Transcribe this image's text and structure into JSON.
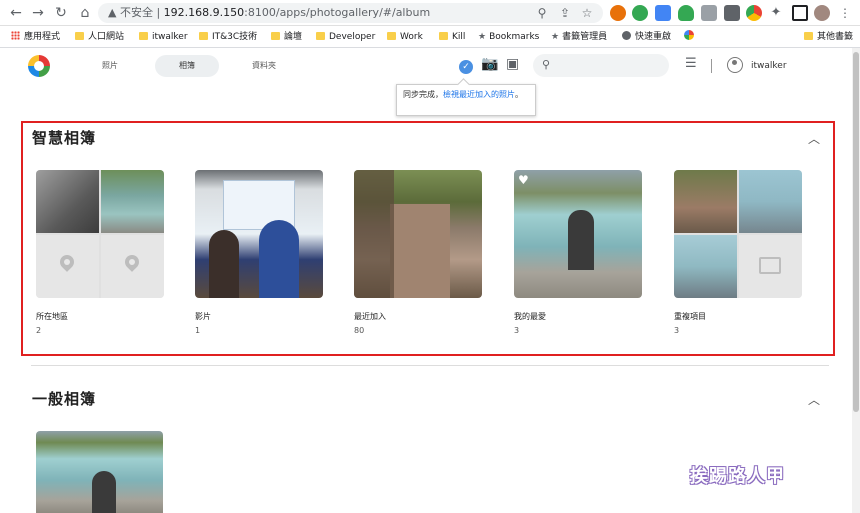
{
  "browser": {
    "insecure_label": "不安全",
    "url_host": "192.168.9.150",
    "url_path": ":8100/apps/photogallery/#/album"
  },
  "bookmarks": {
    "apps": "應用程式",
    "items": [
      "人口網站",
      "itwalker",
      "IT&3C技術",
      "論壇",
      "Developer",
      "Work",
      "Kill"
    ],
    "bookmarks": "Bookmarks",
    "manager": "書籤管理員",
    "speed": "快速重啟",
    "other": "其他書籤"
  },
  "header": {
    "tabs": [
      "照片",
      "相簿",
      "資料夾"
    ],
    "active_tab": 1,
    "username": "itwalker"
  },
  "tooltip": {
    "prefix": "同步完成，",
    "link": "檢視最近加入的照片",
    "suffix": "。"
  },
  "smart_albums": {
    "title": "智慧相簿",
    "items": [
      {
        "label": "所在地區",
        "count": "2"
      },
      {
        "label": "影片",
        "count": "1"
      },
      {
        "label": "最近加入",
        "count": "80"
      },
      {
        "label": "我的最愛",
        "count": "3"
      },
      {
        "label": "重複項目",
        "count": "3"
      }
    ]
  },
  "normal_albums": {
    "title": "一般相簿"
  },
  "watermark": "挨踢路人甲",
  "colors": {
    "highlight_border": "#e02020",
    "sync_check": "#4a90e2"
  }
}
